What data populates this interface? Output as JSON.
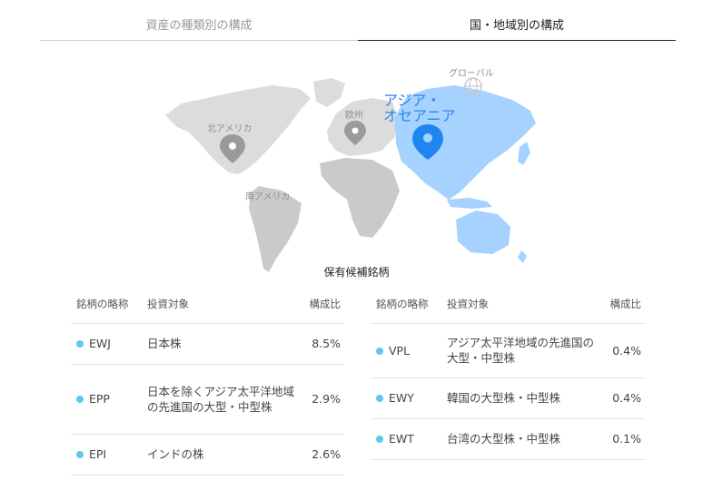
{
  "tabs": [
    {
      "label": "資産の種類別の構成",
      "active": false
    },
    {
      "label": "国・地域別の構成",
      "active": true
    }
  ],
  "map": {
    "regions": {
      "global": "グローバル",
      "north_america": "北アメリカ",
      "europe": "欧州",
      "asia_oceania": "アジア・オセアニア",
      "south_america": "南アメリカ"
    },
    "selected_region": "asia_oceania",
    "colors": {
      "selected": "#a6d2ff",
      "unselected": "#dcdcdc",
      "pin_selected": "#1f86f0",
      "pin_unselected": "#9a9a9a"
    }
  },
  "holdings": {
    "title": "保有候補銘柄",
    "headers": {
      "ticker": "銘柄の略称",
      "target": "投資対象",
      "ratio": "構成比"
    },
    "left": [
      {
        "ticker": "EWJ",
        "target": "日本株",
        "ratio": "8.5%"
      },
      {
        "ticker": "EPP",
        "target": "日本を除くアジア太平洋地域の先進国の大型・中型株",
        "ratio": "2.9%"
      },
      {
        "ticker": "EPI",
        "target": "インドの株",
        "ratio": "2.6%"
      }
    ],
    "right": [
      {
        "ticker": "VPL",
        "target": "アジア太平洋地域の先進国の大型・中型株",
        "ratio": "0.4%"
      },
      {
        "ticker": "EWY",
        "target": "韓国の大型株・中型株",
        "ratio": "0.4%"
      },
      {
        "ticker": "EWT",
        "target": "台湾の大型株・中型株",
        "ratio": "0.1%"
      }
    ],
    "dot_color": "#5bc9f0"
  }
}
